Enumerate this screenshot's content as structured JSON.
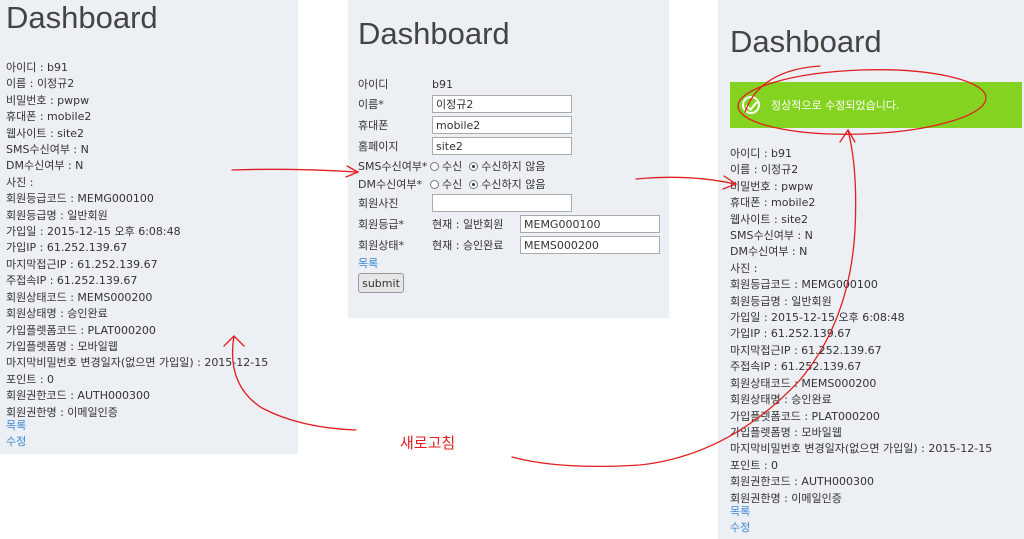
{
  "before": {
    "title": "Dashboard",
    "fields": [
      "아이디 : b91",
      "이름 : 이정규2",
      "비밀번호 : pwpw",
      "휴대폰 : mobile2",
      "웹사이트 : site2",
      "SMS수신여부 : N",
      "DM수신여부 : N",
      "사진 :",
      "회원등급코드 : MEMG000100",
      "회원등급명 : 일반회원",
      "가입일 : 2015-12-15 오후 6:08:48",
      "가입IP : 61.252.139.67",
      "마지막접근IP : 61.252.139.67",
      "주접속IP : 61.252.139.67",
      "회원상태코드 : MEMS000200",
      "회원상태명 : 승인완료",
      "가입플렛폼코드 : PLAT000200",
      "가입플렛폼명 : 모바일웹",
      "마지막비밀번호 변경일자(없으면 가입일) : 2015-12-15",
      "포인트 : 0",
      "회원권한코드 : AUTH000300",
      "회원권한명 : 이메일인증"
    ],
    "list_link": "목록",
    "edit_link": "수정"
  },
  "form": {
    "title": "Dashboard",
    "id_label": "아이디",
    "id_value": "b91",
    "name_label": "이름*",
    "name_value": "이정규2",
    "mobile_label": "휴대폰",
    "mobile_value": "mobile2",
    "homepage_label": "홈페이지",
    "homepage_value": "site2",
    "sms_label": "SMS수신여부*",
    "dm_label": "DM수신여부*",
    "radio_yes": "수신",
    "radio_no": "수신하지 않음",
    "photo_label": "회원사진",
    "photo_value": "",
    "grade_label": "회원등급*",
    "grade_current": "현재 : 일반회원",
    "grade_value": "MEMG000100",
    "status_label": "회원상태*",
    "status_current": "현재 : 승인완료",
    "status_value": "MEMS000200",
    "list_link": "목록",
    "submit_label": "submit"
  },
  "after": {
    "title": "Dashboard",
    "alert_text": "정상적으로 수정되었습니다.",
    "fields": [
      "아이디 : b91",
      "이름 : 이정규2",
      "비밀번호 : pwpw",
      "휴대폰 : mobile2",
      "웹사이트 : site2",
      "SMS수신여부 : N",
      "DM수신여부 : N",
      "사진 :",
      "회원등급코드 : MEMG000100",
      "회원등급명 : 일반회원",
      "가입일 : 2015-12-15 오후 6:08:48",
      "가입IP : 61.252.139.67",
      "마지막접근IP : 61.252.139.67",
      "주접속IP : 61.252.139.67",
      "회원상태코드 : MEMS000200",
      "회원상태명 : 승인완료",
      "가입플렛폼코드 : PLAT000200",
      "가입플렛폼명 : 모바일웹",
      "마지막비밀번호 변경일자(없으면 가입일) : 2015-12-15",
      "포인트 : 0",
      "회원권한코드 : AUTH000300",
      "회원권한명 : 이메일인증"
    ],
    "list_link": "목록",
    "edit_link": "수정"
  },
  "annotation": "새로고침",
  "colors": {
    "annotation": "#e02020",
    "alert_bg": "#84d320",
    "link": "#3a87d4",
    "panel_bg": "#eceff4"
  }
}
